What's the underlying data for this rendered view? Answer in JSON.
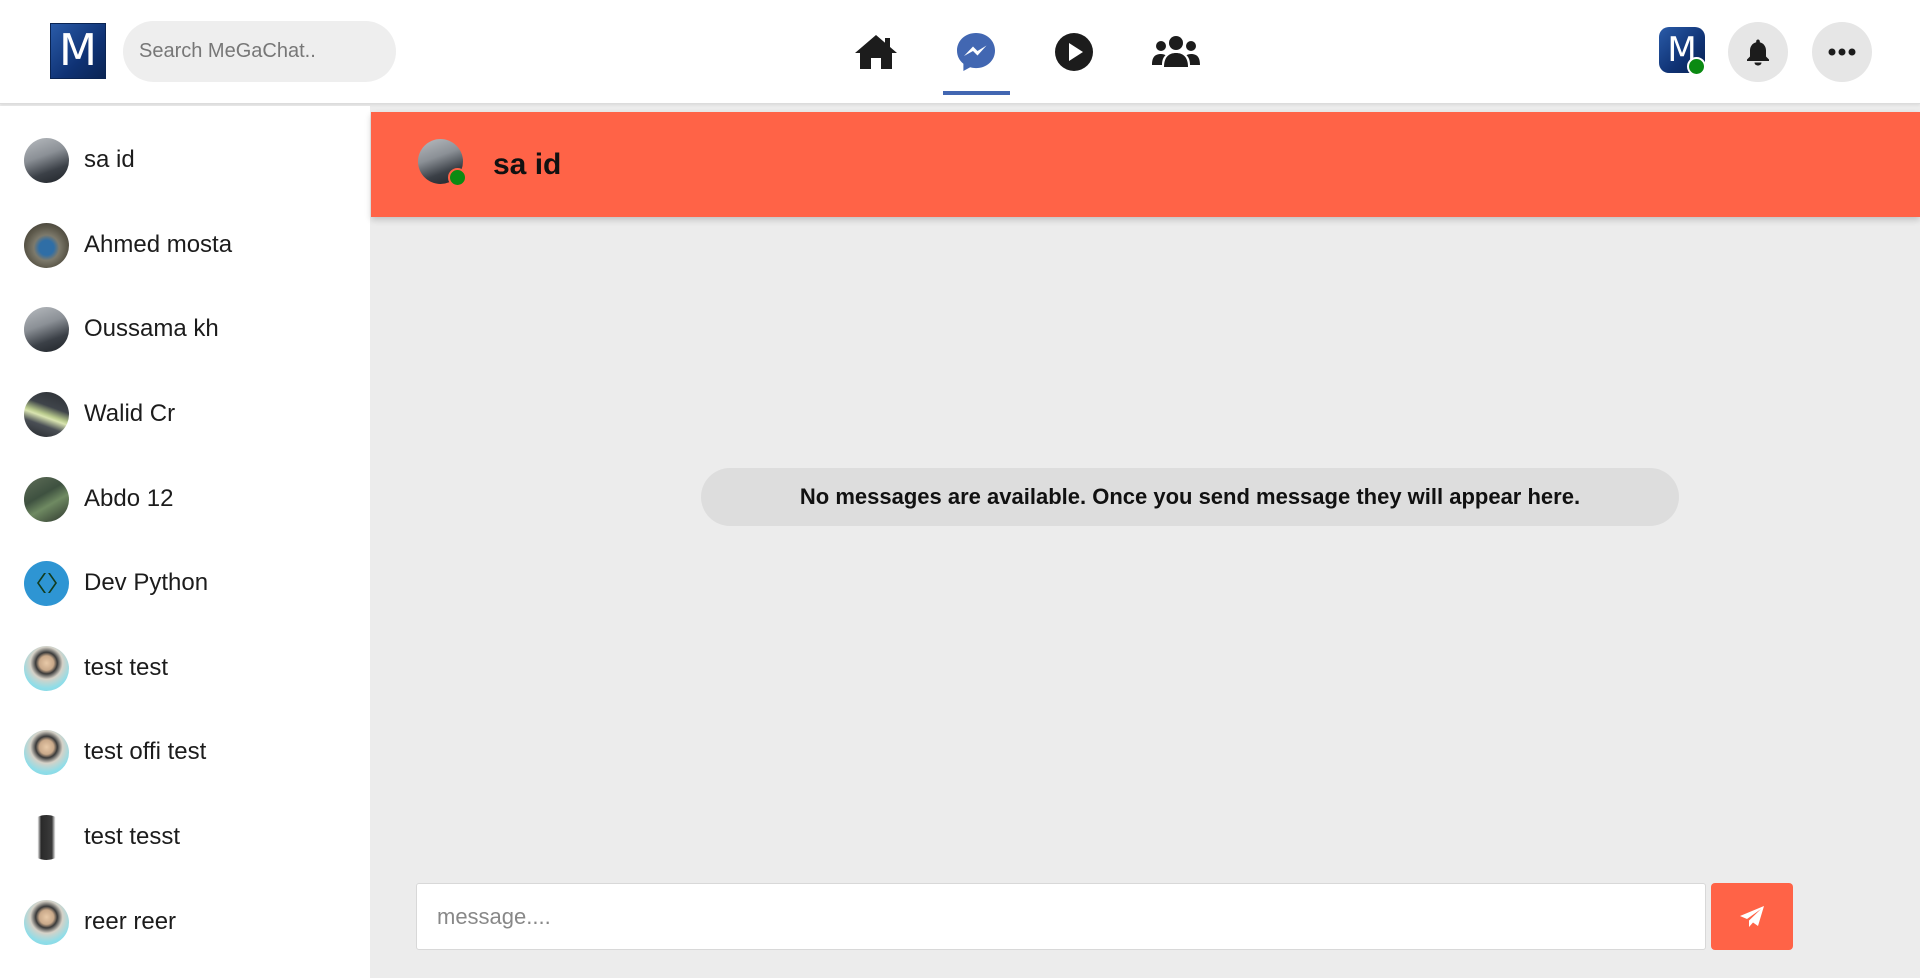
{
  "brand": {
    "logo_letter": "M"
  },
  "search": {
    "placeholder": "Search MeGaChat.."
  },
  "nav": {
    "items": [
      {
        "icon": "home-icon",
        "active": false
      },
      {
        "icon": "messenger-icon",
        "active": true
      },
      {
        "icon": "play-icon",
        "active": false
      },
      {
        "icon": "groups-icon",
        "active": false
      }
    ]
  },
  "user": {
    "avatar_letter": "M",
    "online": true
  },
  "contacts": [
    {
      "name": "sa id",
      "avatar": "desk-photo"
    },
    {
      "name": "Ahmed mosta",
      "avatar": "masked-person-photo"
    },
    {
      "name": "Oussama kh",
      "avatar": "desk-photo"
    },
    {
      "name": "Walid Cr",
      "avatar": "green-streak-photo"
    },
    {
      "name": "Abdo 12",
      "avatar": "green-object-photo"
    },
    {
      "name": "Dev Python",
      "avatar": "code-logo"
    },
    {
      "name": "test test",
      "avatar": "woman-sunglasses-photo"
    },
    {
      "name": "test offi test",
      "avatar": "woman-sunglasses-photo"
    },
    {
      "name": "test tesst",
      "avatar": "man-suit-photo"
    },
    {
      "name": "reer reer",
      "avatar": "woman-sunglasses-photo"
    }
  ],
  "chat": {
    "title": "sa id",
    "online": true,
    "empty_message": "No messages are available. Once you send message they will appear here."
  },
  "composer": {
    "placeholder": "message...."
  },
  "colors": {
    "accent": "#ff6347",
    "nav_active": "#4267b2",
    "online": "#0b8a12"
  }
}
